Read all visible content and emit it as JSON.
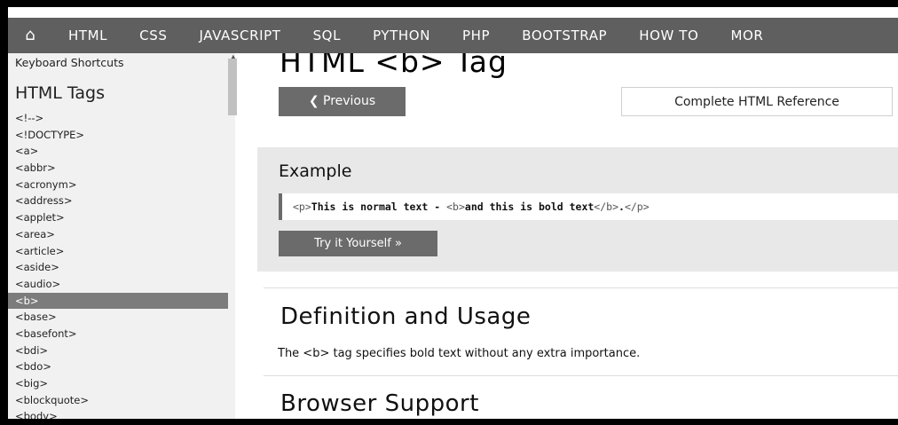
{
  "topnav": {
    "home_icon": "home-icon",
    "items": [
      "HTML",
      "CSS",
      "JAVASCRIPT",
      "SQL",
      "PYTHON",
      "PHP",
      "BOOTSTRAP",
      "HOW TO",
      "MOR"
    ]
  },
  "sidebar": {
    "shortcuts_label": "Keyboard Shortcuts",
    "heading": "HTML Tags",
    "items": [
      "<!-->",
      "<!DOCTYPE>",
      "<a>",
      "<abbr>",
      "<acronym>",
      "<address>",
      "<applet>",
      "<area>",
      "<article>",
      "<aside>",
      "<audio>",
      "<b>",
      "<base>",
      "<basefont>",
      "<bdi>",
      "<bdo>",
      "<big>",
      "<blockquote>",
      "<body>"
    ],
    "active_item": "<b>"
  },
  "main": {
    "title": "HTML <b> Tag",
    "prev_label": "❮ Previous",
    "reference_label": "Complete HTML Reference",
    "example": {
      "title": "Example",
      "code_parts": [
        "<p>",
        "This is normal text - ",
        "<b>",
        "and this is bold text",
        "</b>",
        ".",
        "</p>"
      ],
      "try_label": "Try it Yourself »"
    },
    "definition_heading": "Definition and Usage",
    "definition_text": "The <b> tag specifies bold text without any extra importance.",
    "browser_support_heading": "Browser Support"
  },
  "colors": {
    "nav_bg": "#5f5f5f",
    "sidebar_bg": "#f1f1f1",
    "active_bg": "#7c7c7c",
    "button_bg": "#6b6b6b",
    "example_bg": "#e8e8e8"
  }
}
